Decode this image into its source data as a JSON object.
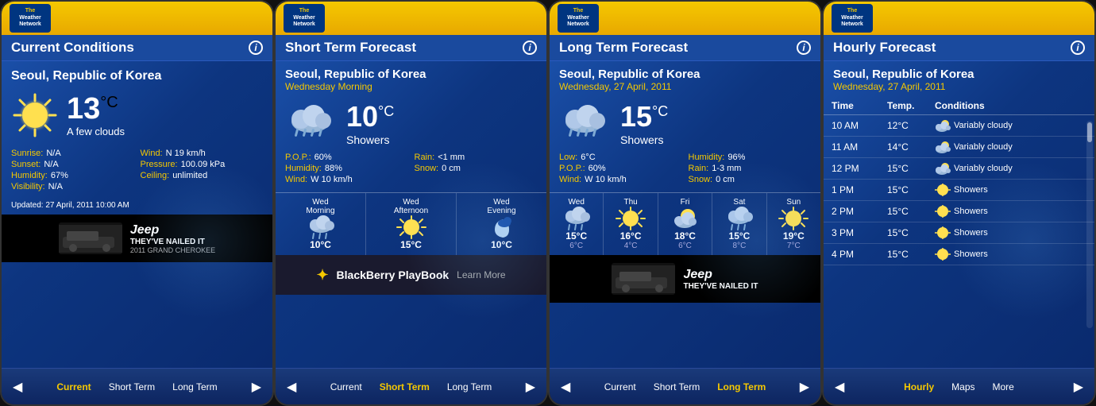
{
  "panel1": {
    "title": "Current Conditions",
    "city": "Seoul, Republic of Korea",
    "temp": "13",
    "temp_unit": "°C",
    "condition": "A few clouds",
    "sunrise": "N/A",
    "sunset": "N/A",
    "humidity": "67%",
    "visibility": "N/A",
    "wind": "N 19 km/h",
    "pressure": "100.09 kPa",
    "ceiling": "unlimited",
    "updated": "Updated: 27 April, 2011 10:00 AM",
    "nav": {
      "left_arrow": "◀",
      "right_arrow": "▶",
      "items": [
        "Current",
        "Short Term",
        "Long Term"
      ],
      "active": "Current"
    }
  },
  "panel2": {
    "title": "Short Term Forecast",
    "city": "Seoul, Republic of Korea",
    "subtitle": "Wednesday Morning",
    "temp": "10",
    "temp_unit": "°C",
    "condition": "Showers",
    "pop": "60%",
    "rain": "<1 mm",
    "humidity": "88%",
    "snow": "0 cm",
    "wind": "W 10 km/h",
    "periods": [
      {
        "label1": "Wed",
        "label2": "Morning",
        "temp": "10°C"
      },
      {
        "label1": "Wed",
        "label2": "Afternoon",
        "temp": "15°C"
      },
      {
        "label1": "Wed",
        "label2": "Evening",
        "temp": "10°C"
      }
    ],
    "nav": {
      "left_arrow": "◀",
      "right_arrow": "▶",
      "items": [
        "Current",
        "Short Term",
        "Long Term"
      ],
      "active": "Short Term"
    },
    "ad_text": "Learn More",
    "ad_brand": "BlackBerry PlayBook"
  },
  "panel3": {
    "title": "Long Term Forecast",
    "city": "Seoul, Republic of Korea",
    "subtitle": "Wednesday, 27 April, 2011",
    "temp": "15",
    "temp_unit": "°C",
    "condition": "Showers",
    "low": "6°C",
    "pop": "60%",
    "wind": "W 10 km/h",
    "humidity": "96%",
    "rain": "1-3 mm",
    "snow": "0 cm",
    "days": [
      {
        "label": "Wed",
        "high": "15°C",
        "low": "6°C"
      },
      {
        "label": "Thu",
        "high": "16°C",
        "low": "4°C"
      },
      {
        "label": "Fri",
        "high": "18°C",
        "low": "6°C"
      },
      {
        "label": "Sat",
        "high": "15°C",
        "low": "8°C"
      },
      {
        "label": "Sun",
        "high": "19°C",
        "low": "7°C"
      }
    ],
    "nav": {
      "left_arrow": "◀",
      "right_arrow": "▶",
      "items": [
        "Current",
        "Short Term",
        "Long Term"
      ],
      "active": "Long Term"
    }
  },
  "panel4": {
    "title": "Hourly Forecast",
    "city": "Seoul, Republic of Korea",
    "subtitle": "Wednesday, 27 April, 2011",
    "header": {
      "time": "Time",
      "temp": "Temp.",
      "conditions": "Conditions"
    },
    "rows": [
      {
        "time": "10 AM",
        "temp": "12°C",
        "condition": "Variably cloudy",
        "icon": "cloud-sun"
      },
      {
        "time": "11 AM",
        "temp": "14°C",
        "condition": "Variably cloudy",
        "icon": "cloud-sun"
      },
      {
        "time": "12 PM",
        "temp": "15°C",
        "condition": "Variably cloudy",
        "icon": "cloud-sun"
      },
      {
        "time": "1 PM",
        "temp": "15°C",
        "condition": "Showers",
        "icon": "sun"
      },
      {
        "time": "2 PM",
        "temp": "15°C",
        "condition": "Showers",
        "icon": "sun"
      },
      {
        "time": "3 PM",
        "temp": "15°C",
        "condition": "Showers",
        "icon": "sun"
      },
      {
        "time": "4 PM",
        "temp": "15°C",
        "condition": "Showers",
        "icon": "sun"
      }
    ],
    "nav": {
      "left_arrow": "◀",
      "right_arrow": "▶",
      "items": [
        "Hourly",
        "Maps",
        "More"
      ],
      "active": "Hourly"
    }
  },
  "labels": {
    "sunrise": "Sunrise:",
    "sunset": "Sunset:",
    "humidity": "Humidity:",
    "visibility": "Visibility:",
    "wind": "Wind:",
    "pressure": "Pressure:",
    "ceiling": "Ceiling:",
    "pop": "P.O.P.:",
    "rain": "Rain:",
    "snow": "Snow:",
    "low": "Low:",
    "info_i": "i"
  }
}
